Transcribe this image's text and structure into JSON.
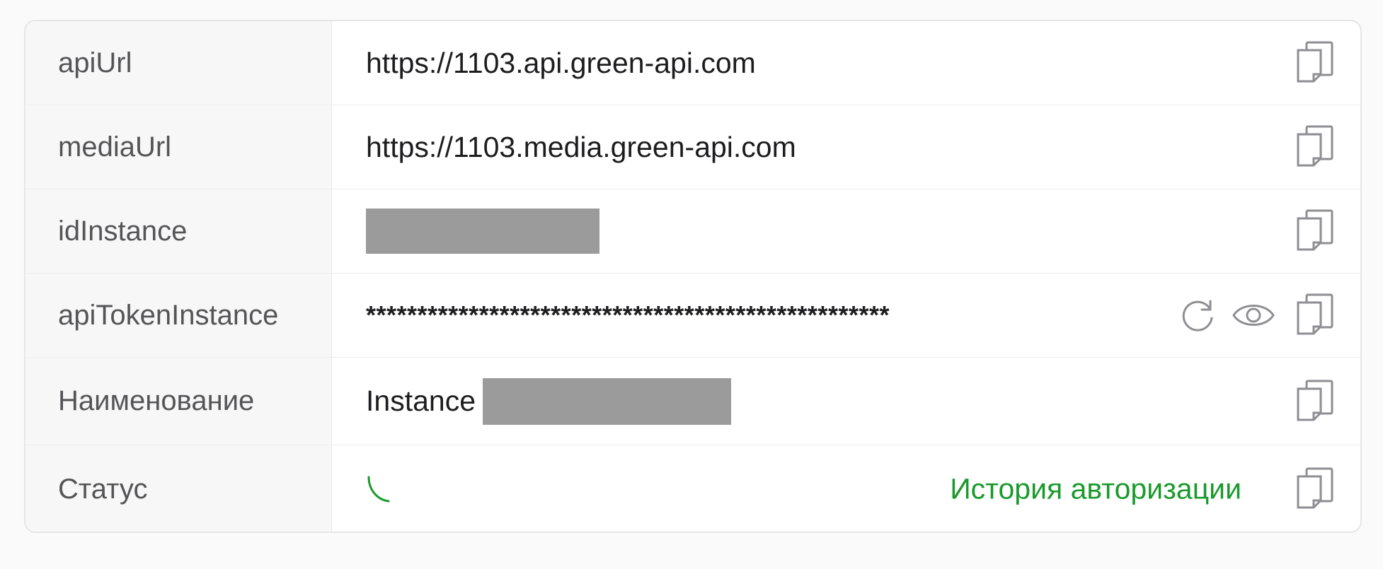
{
  "rows": [
    {
      "label": "apiUrl",
      "value": "https://1103.api.green-api.com"
    },
    {
      "label": "mediaUrl",
      "value": "https://1103.media.green-api.com"
    },
    {
      "label": "idInstance",
      "value": ""
    },
    {
      "label": "apiTokenInstance",
      "value": "***************************************************"
    },
    {
      "label": "Наименование",
      "value": "Instance"
    },
    {
      "label": "Статус",
      "value": ""
    }
  ],
  "status": {
    "history_link": "История авторизации",
    "accent_color": "#1a9a2c"
  },
  "icons": {
    "copy": "copy-icon",
    "eye": "eye-icon",
    "refresh": "refresh-icon",
    "status": "phone-arc-icon"
  }
}
